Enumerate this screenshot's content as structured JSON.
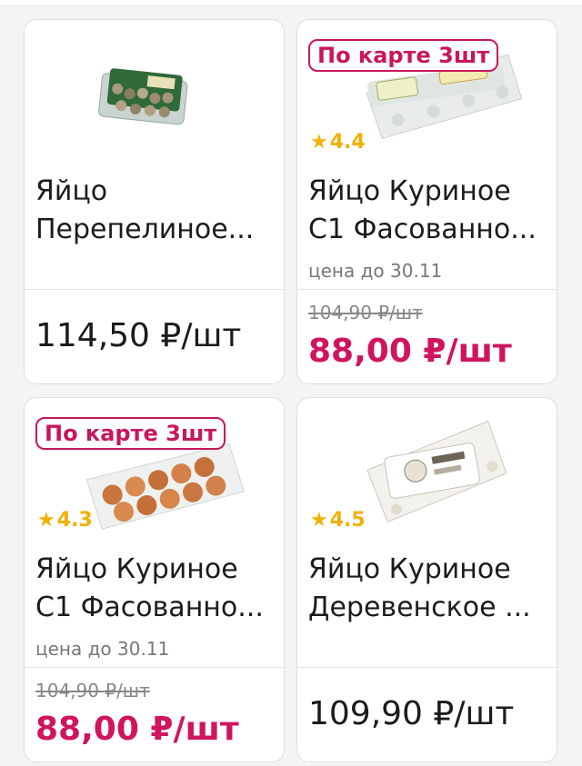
{
  "products": [
    {
      "title_line1": "Яйцо",
      "title_line2": "Перепелиное...",
      "price": "114,50 ₽/шт",
      "image": "quail-egg-pack-icon"
    },
    {
      "badge": "По карте 3шт",
      "rating": "4.4",
      "title_line1": "Яйцо Куриное",
      "title_line2": "С1 Фасованно...",
      "note": "цена до 30.11",
      "old_price": "104,90 ₽/шт",
      "price": "88,00 ₽/шт",
      "image": "egg-carton-icon"
    },
    {
      "badge": "По карте 3шт",
      "rating": "4.3",
      "title_line1": "Яйцо Куриное",
      "title_line2": "С1 Фасованно...",
      "note": "цена до 30.11",
      "old_price": "104,90 ₽/шт",
      "price": "88,00 ₽/шт",
      "image": "brown-eggs-carton-icon"
    },
    {
      "rating": "4.5",
      "title_line1": "Яйцо Куриное",
      "title_line2": "Деревенское ...",
      "price": "109,90 ₽/шт",
      "image": "village-egg-carton-icon"
    }
  ],
  "colors": {
    "accent": "#d0145e",
    "star": "#f2b000"
  }
}
